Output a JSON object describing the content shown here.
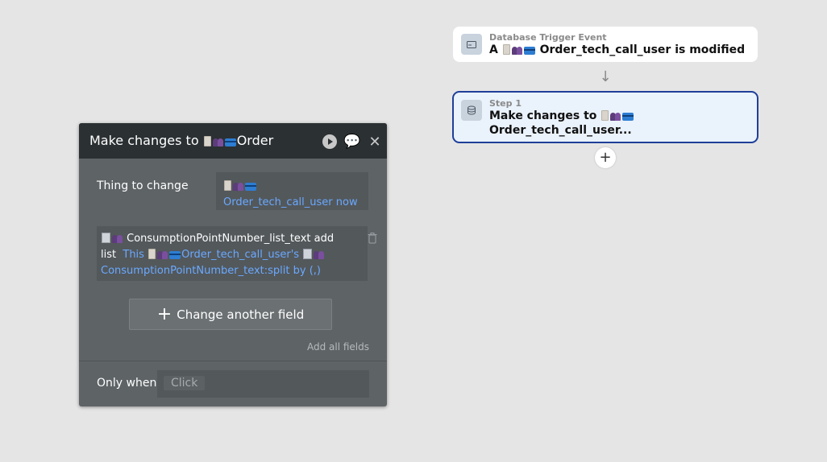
{
  "trigger": {
    "subtitle": "Database Trigger Event",
    "prefix": "A",
    "type_name": "Order_tech_call_user",
    "suffix": "is modified",
    "icon": "monitor-icon"
  },
  "step": {
    "subtitle": "Step 1",
    "action": "Make changes to",
    "type_name": "Order_tech_call_user...",
    "icon": "database-icon"
  },
  "editor": {
    "title_prefix": "Make changes to",
    "title_type": "Order",
    "thing_to_change_label": "Thing to change",
    "thing_value": "Order_tech_call_user now",
    "field": {
      "name": "ConsumptionPointNumber_list_text add",
      "word_list": "list",
      "this_text": "This",
      "source_type": "Order_tech_call_user's",
      "source_field": "ConsumptionPointNumber_text:split by (,)"
    },
    "change_another_label": "Change another field",
    "add_all_label": "Add all fields",
    "only_when_label": "Only when",
    "only_when_placeholder": "Click"
  },
  "colors": {
    "accent_blue": "#6aa9ff",
    "selected_border": "#1f3f99",
    "editor_bg": "#5e6366",
    "header_bg": "#2b3033"
  }
}
